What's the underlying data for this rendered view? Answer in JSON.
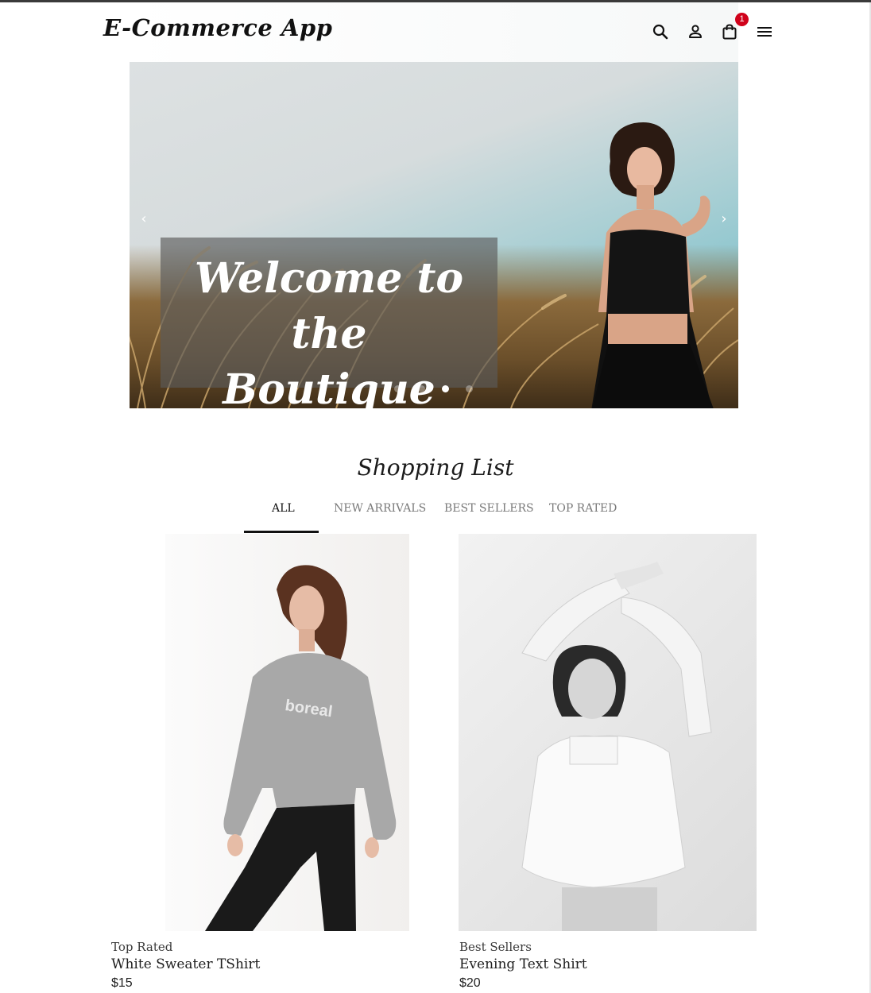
{
  "header": {
    "logo": "E-Commerce App",
    "cart_count": "1",
    "icons": [
      "search-icon",
      "user-icon",
      "shopping-bag-icon",
      "menu-icon"
    ]
  },
  "hero": {
    "title": "Welcome to the\nBoutique",
    "slide_count": 4,
    "active_slide": 3,
    "prev_arrow": "‹",
    "next_arrow": "›"
  },
  "shopping": {
    "title": "Shopping List",
    "tabs": [
      "ALL",
      "NEW ARRIVALS",
      "BEST SELLERS",
      "TOP RATED"
    ],
    "active_tab": "ALL",
    "products": [
      {
        "category": "Top Rated",
        "name": "White Sweater TShirt",
        "price": "$15"
      },
      {
        "category": "Best Sellers",
        "name": "Evening Text Shirt",
        "price": "$20"
      }
    ]
  },
  "colors": {
    "badge": "#d0021b",
    "accent": "#111111"
  }
}
